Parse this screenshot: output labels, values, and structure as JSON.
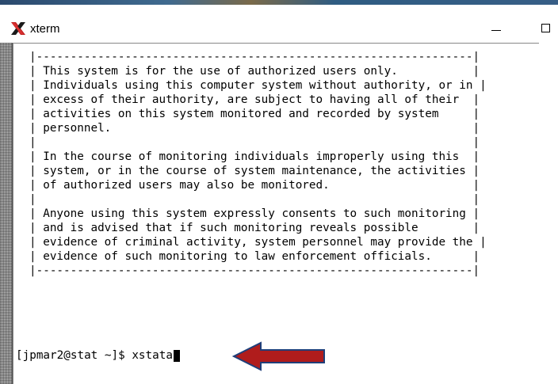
{
  "window": {
    "title": "xterm",
    "app_icon": "xterm-x-icon",
    "controls": [
      "minimize-icon",
      "maximize-icon"
    ]
  },
  "terminal": {
    "banner_lines": [
      "|----------------------------------------------------------------|",
      "| This system is for the use of authorized users only.           |",
      "| Individuals using this computer system without authority, or in |",
      "| excess of their authority, are subject to having all of their  |",
      "| activities on this system monitored and recorded by system     |",
      "| personnel.                                                     |",
      "|                                                                |",
      "| In the course of monitoring individuals improperly using this  |",
      "| system, or in the course of system maintenance, the activities |",
      "| of authorized users may also be monitored.                     |",
      "|                                                                |",
      "| Anyone using this system expressly consents to such monitoring |",
      "| and is advised that if such monitoring reveals possible        |",
      "| evidence of criminal activity, system personnel may provide the |",
      "| evidence of such monitoring to law enforcement officials.      |",
      "|----------------------------------------------------------------|"
    ],
    "prompt": "[jpmar2@stat ~]$ ",
    "command": "xstata"
  },
  "annotation": {
    "arrow_color": "#b01c1c",
    "arrow_outline": "#1f3f7a",
    "points_to": "command"
  },
  "colors": {
    "terminal_bg": "#ffffff",
    "terminal_fg": "#000000",
    "scrollbar": "#c8c8c8"
  }
}
